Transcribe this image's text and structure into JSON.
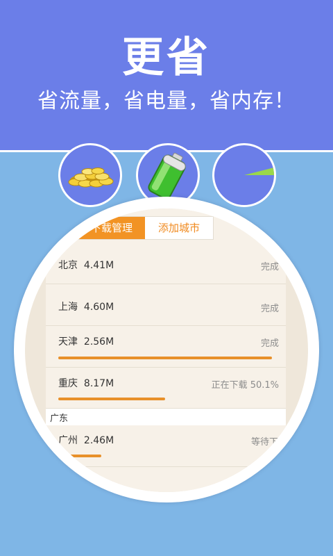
{
  "hero": {
    "title": "更省",
    "subtitle": "省流量，省电量，省内存！"
  },
  "features": [
    {
      "icon": "gold-coins-icon"
    },
    {
      "icon": "battery-icon"
    },
    {
      "icon": "pie-chart-icon"
    }
  ],
  "tabs": [
    {
      "label": "下载管理",
      "active": true
    },
    {
      "label": "添加城市",
      "active": false
    }
  ],
  "downloads": [
    {
      "city": "北京",
      "size": "4.41M",
      "status": "完成"
    },
    {
      "city": "上海",
      "size": "4.60M",
      "status": "完成"
    },
    {
      "city": "天津",
      "size": "2.56M",
      "status": "完成",
      "progress": 1.0
    },
    {
      "city": "重庆",
      "size": "8.17M",
      "status": "正在下载  50.1%",
      "progress": 0.501
    },
    {
      "section": "广东"
    },
    {
      "city": "广州",
      "size": "2.46M",
      "status": "等待下载",
      "progress": 0.2
    }
  ],
  "colors": {
    "hero_bg": "#6b7ee8",
    "page_bg": "#7fb6e6",
    "accent": "#f29324",
    "progress": "#e8902a"
  }
}
